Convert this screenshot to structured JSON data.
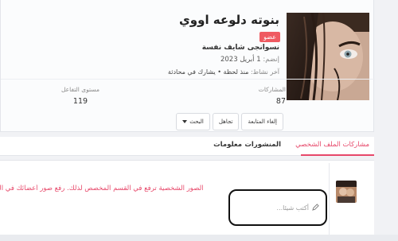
{
  "profile": {
    "username": "بنوته دلوعه اووي",
    "rank_badge": "عضو",
    "user_title": "نسوانجى شايف نفسة",
    "joined_label": "إنضم:",
    "joined_value": "1 أبريل 2023",
    "last_active_label": "آخر نشاط:",
    "last_active_value": "منذ لحظة • يشارك في محادثة",
    "stats": {
      "posts_label": "المشاركات",
      "posts_value": "87",
      "reaction_label": "مستوى التفاعل",
      "reaction_value": "119"
    },
    "actions": {
      "unfollow": "إلغاء المتابعة",
      "ignore": "تجاهل",
      "search": "البحث"
    }
  },
  "tabs": [
    {
      "label": "مشاركات الملف الشخصي",
      "active": true
    },
    {
      "label": "المنشورات",
      "active": false
    },
    {
      "label": "معلومات",
      "active": false
    }
  ],
  "notice_text": "الصور الشخصية ترفع في القسم المخصص لذلك. رفع صور أعضائك في التعليقات او في الأقسام الغير مخ",
  "composer": {
    "placeholder": "أكتب شيئا..."
  },
  "colors": {
    "accent": "#e7486a",
    "badge": "#ef5a61"
  },
  "icons": {
    "composer": "pencil-icon",
    "search_dropdown": "chevron-down-icon"
  }
}
